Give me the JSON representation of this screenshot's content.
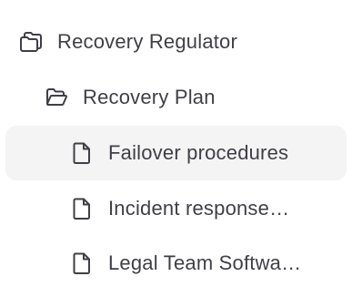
{
  "tree": {
    "items": [
      {
        "label": "Recovery Regulator",
        "icon": "collection-icon",
        "level": 0,
        "selected": false
      },
      {
        "label": "Recovery Plan",
        "icon": "folder-open-icon",
        "level": 1,
        "selected": false
      },
      {
        "label": "Failover procedures",
        "icon": "document-icon",
        "level": 2,
        "selected": true
      },
      {
        "label": "Incident response…",
        "icon": "document-icon",
        "level": 2,
        "selected": false
      },
      {
        "label": "Legal Team Softwa…",
        "icon": "document-icon",
        "level": 2,
        "selected": false
      }
    ]
  },
  "colors": {
    "text": "#3f3f46",
    "icon_stroke": "#3f3f46",
    "selected_bg": "#f4f4f5"
  }
}
